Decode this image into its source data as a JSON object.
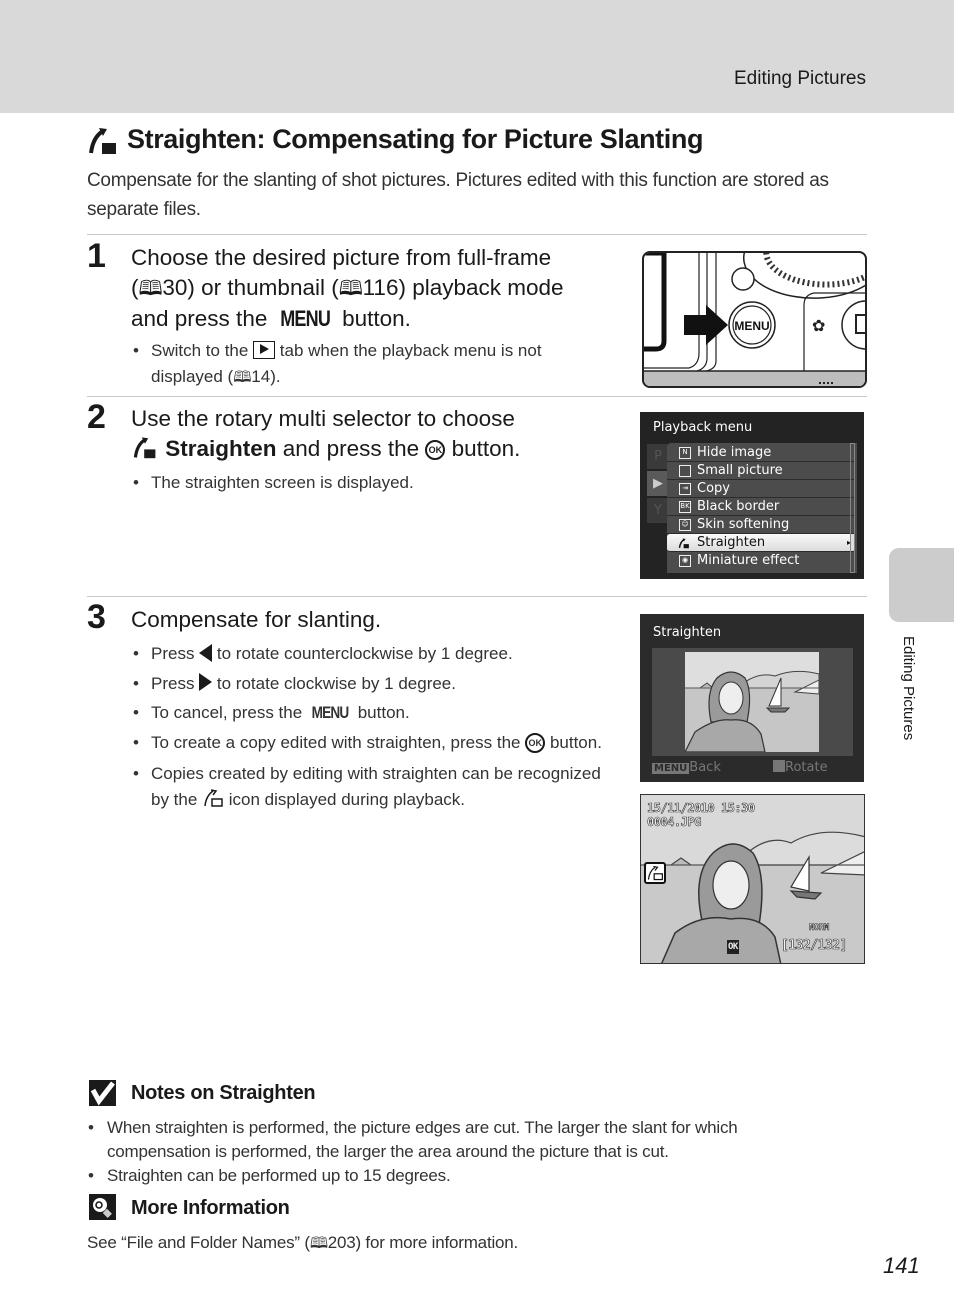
{
  "header": {
    "section_title": "Editing Pictures"
  },
  "side_tab": {
    "label": "Editing Pictures"
  },
  "title": {
    "icon": "straighten-icon",
    "text": "Straighten: Compensating for Picture Slanting"
  },
  "intro": "Compensate for the slanting of shot pictures. Pictures edited with this function are stored as separate files.",
  "steps": [
    {
      "number": "1",
      "heading_parts": {
        "line1": "Choose the desired picture from full-frame",
        "ref1_open": "(",
        "ref1_page": "30",
        "ref1_mid": ") or thumbnail (",
        "ref2_page": "116",
        "ref2_close": ") playback mode",
        "line3_pre": "and press the ",
        "menu_glyph": "MENU",
        "line3_post": " button."
      },
      "bullets": [
        {
          "pre": "Switch to the ",
          "icon": "play-tab-icon",
          "post": " tab when the playback menu is not displayed (",
          "ref": "14",
          "end": ")."
        }
      ],
      "illustration": {
        "button_label": "MENU",
        "icon": "menu-button-illustration"
      }
    },
    {
      "number": "2",
      "heading_parts": {
        "line1": "Use the rotary multi selector to choose",
        "bold": "Straighten",
        "mid": " and press the ",
        "ok_glyph": "OK",
        "post": " button."
      },
      "bullets": [
        {
          "text": "The straighten screen is displayed."
        }
      ],
      "screen": {
        "title": "Playback menu",
        "tabs": [
          "P",
          "▶",
          "Y"
        ],
        "active_tab": 1,
        "items": [
          {
            "label": "Hide image",
            "icon": "hide-image-icon"
          },
          {
            "label": "Small picture",
            "icon": "small-picture-icon"
          },
          {
            "label": "Copy",
            "icon": "copy-icon"
          },
          {
            "label": "Black border",
            "icon": "black-border-icon"
          },
          {
            "label": "Skin softening",
            "icon": "skin-softening-icon"
          },
          {
            "label": "Straighten",
            "icon": "straighten-icon",
            "selected": true
          },
          {
            "label": "Miniature effect",
            "icon": "miniature-effect-icon"
          }
        ]
      }
    },
    {
      "number": "3",
      "heading": "Compensate for slanting.",
      "bullets": [
        {
          "pre": "Press ",
          "icon": "left-arrow",
          "post": " to rotate counterclockwise by 1 degree."
        },
        {
          "pre": "Press ",
          "icon": "right-arrow",
          "post": " to rotate clockwise by 1 degree."
        },
        {
          "pre": "To cancel, press the ",
          "glyph": "MENU",
          "post": " button."
        },
        {
          "pre": "To create a copy edited with straighten, press the ",
          "glyph": "OK",
          "post": " button."
        },
        {
          "pre": "Copies created by editing with straighten can be recognized by the ",
          "icon": "straighten-copy-icon",
          "post": " icon displayed during playback."
        }
      ],
      "straighten_screen": {
        "title": "Straighten",
        "back_key": "MENU",
        "back_label": "Back",
        "rotate_label": "Rotate"
      },
      "playback_screen": {
        "date_time": "15/11/2010 15:30",
        "file_name": "0004.JPG",
        "quality": "NORM",
        "frame_counter": "[132/132]",
        "ok_hint": "OK"
      }
    }
  ],
  "notes": {
    "heading": "Notes on Straighten",
    "icon": "checkmark-icon",
    "items": [
      "When straighten is performed, the picture edges are cut. The larger the slant for which compensation is performed, the larger the area around the picture that is cut.",
      "Straighten can be performed up to 15 degrees."
    ]
  },
  "more_info": {
    "heading": "More Information",
    "icon": "lightbulb-icon",
    "pre": "See “File and Folder Names” (",
    "ref": "203",
    "post": ") for more information."
  },
  "page_number": "141"
}
